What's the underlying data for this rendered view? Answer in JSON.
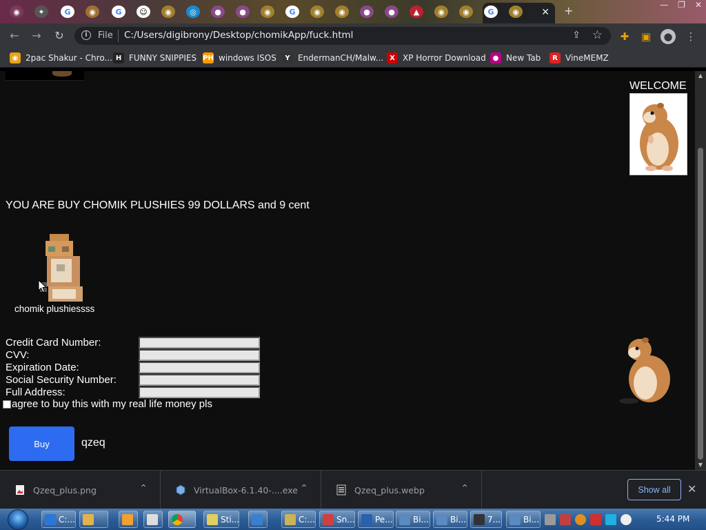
{
  "browser": {
    "url_scheme": "File",
    "url": "C:/Users/digibrony/Desktop/chomikApp/fuck.html",
    "tab_close": "✕",
    "new_tab": "+",
    "bookmarks": [
      {
        "label": "2pac Shakur - Chro...",
        "icon_color": "#e8a317",
        "icon_text": "◉"
      },
      {
        "label": "FUNNY SNIPPIES",
        "icon_color": "#222",
        "icon_text": "H"
      },
      {
        "label": "windows ISOS",
        "icon_color": "#f90",
        "icon_text": "PH"
      },
      {
        "label": "EndermanCH/Malw...",
        "icon_color": "#333",
        "icon_text": "Y"
      },
      {
        "label": "XP Horror Download",
        "icon_color": "#c00",
        "icon_text": "X"
      },
      {
        "label": "New Tab",
        "icon_color": "#b08",
        "icon_text": "●"
      },
      {
        "label": "VineMEMZ",
        "icon_color": "#d22",
        "icon_text": "R"
      }
    ]
  },
  "page": {
    "welcome": "WELCOME",
    "headline": "YOU ARE BUY CHOMIK PLUSHIES 99 DOLLARS and 9 cent",
    "plush_caption": "chomik plushiessss",
    "form": {
      "fields": [
        {
          "label": "Credit Card Number:",
          "value": ""
        },
        {
          "label": "CVV:",
          "value": ""
        },
        {
          "label": "Expiration Date:",
          "value": ""
        },
        {
          "label": "Social Security Number:",
          "value": ""
        },
        {
          "label": "Full Address:",
          "value": ""
        }
      ],
      "agree_label": "agree to buy this with my real life money pls",
      "agree_checked": false,
      "buy_label": "Buy",
      "result_text": "qzeq"
    }
  },
  "downloads": {
    "items": [
      {
        "name": "Qzeq_plus.png"
      },
      {
        "name": "VirtualBox-6.1.40-....exe"
      },
      {
        "name": "Qzeq_plus.webp"
      }
    ],
    "show_all": "Show all",
    "close": "✕"
  },
  "taskbar": {
    "items": [
      {
        "label": "C:...",
        "color": "#2a78d6"
      },
      {
        "label": "",
        "color": "#e2b34a"
      },
      {
        "label": "",
        "color": "#f0a030"
      },
      {
        "label": "",
        "color": "#ddd"
      },
      {
        "label": "",
        "color": "#4caf50"
      },
      {
        "label": "Sti...",
        "color": "#e0d060"
      },
      {
        "label": "",
        "color": "#3a80d0"
      },
      {
        "label": "C:...",
        "color": "#c9b458"
      },
      {
        "label": "Sn...",
        "color": "#d04040"
      },
      {
        "label": "Pe...",
        "color": "#2a60b0"
      },
      {
        "label": "Bi...",
        "color": "#5a8ac0"
      },
      {
        "label": "Bi...",
        "color": "#5a8ac0"
      },
      {
        "label": "7...",
        "color": "#333"
      },
      {
        "label": "Bi...",
        "color": "#5a8ac0"
      }
    ],
    "clock": "5:44 PM"
  }
}
